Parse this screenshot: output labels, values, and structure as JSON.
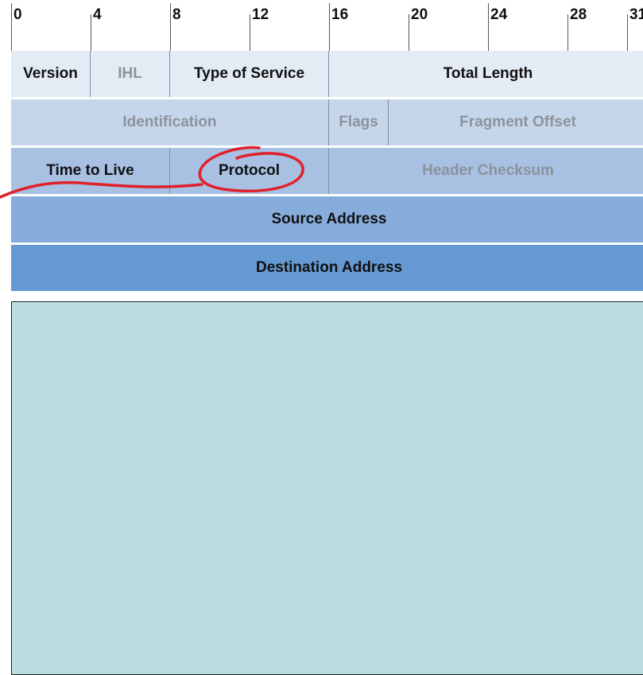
{
  "bit_ruler": {
    "ticks": [
      {
        "label": "0",
        "bit": 0
      },
      {
        "label": "4",
        "bit": 4
      },
      {
        "label": "8",
        "bit": 8
      },
      {
        "label": "12",
        "bit": 12
      },
      {
        "label": "16",
        "bit": 16
      },
      {
        "label": "20",
        "bit": 20
      },
      {
        "label": "24",
        "bit": 24
      },
      {
        "label": "28",
        "bit": 28
      },
      {
        "label": "31",
        "bit": 31
      }
    ]
  },
  "rows": [
    {
      "color": "#e3ebf5",
      "fields": [
        {
          "label": "Version",
          "bits": 4,
          "muted": false
        },
        {
          "label": "IHL",
          "bits": 4,
          "muted": true
        },
        {
          "label": "Type of Service",
          "bits": 8,
          "muted": false
        },
        {
          "label": "Total Length",
          "bits": 16,
          "muted": false
        }
      ]
    },
    {
      "color": "#c6d6ea",
      "fields": [
        {
          "label": "Identification",
          "bits": 16,
          "muted": true
        },
        {
          "label": "Flags",
          "bits": 3,
          "muted": true
        },
        {
          "label": "Fragment Offset",
          "bits": 13,
          "muted": true
        }
      ]
    },
    {
      "color": "#a8c0e2",
      "fields": [
        {
          "label": "Time to Live",
          "bits": 8,
          "muted": false
        },
        {
          "label": "Protocol",
          "bits": 8,
          "muted": false
        },
        {
          "label": "Header Checksum",
          "bits": 16,
          "muted": true
        }
      ]
    },
    {
      "color": "#86acdc",
      "fields": [
        {
          "label": "Source Address",
          "bits": 32,
          "muted": false
        }
      ]
    },
    {
      "color": "#6499d2",
      "fields": [
        {
          "label": "Destination Address",
          "bits": 32,
          "muted": false
        }
      ]
    }
  ],
  "colors": {
    "text_dark": "#111111",
    "text_muted": "#8c929c",
    "annotation": "#e0202a",
    "panel": "#bbdfe1"
  },
  "annotation": {
    "circled_field": "Protocol"
  }
}
